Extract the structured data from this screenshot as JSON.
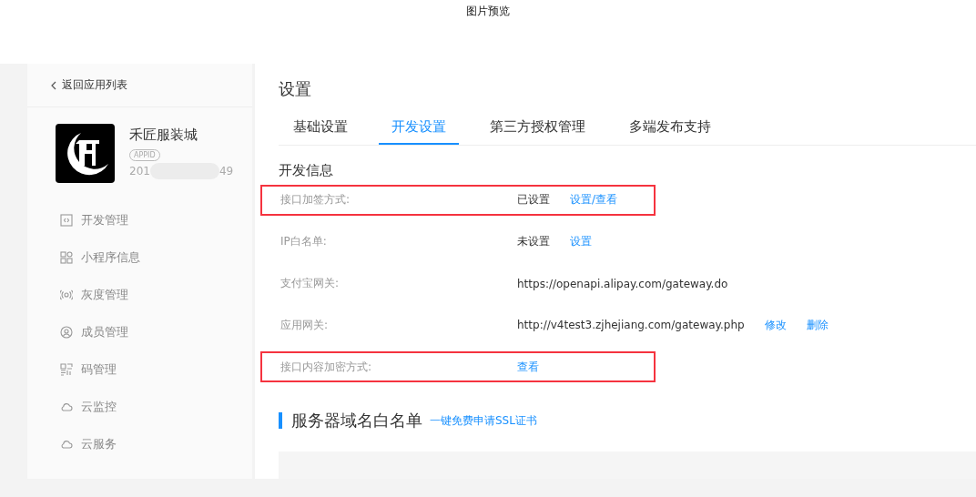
{
  "window": {
    "title": "图片预览"
  },
  "sidebar": {
    "back_link": "返回应用列表",
    "app": {
      "name": "禾匠服装城",
      "appid_badge": "APPID",
      "appid_start": "201",
      "appid_end": "49"
    },
    "items": [
      {
        "label": "开发管理",
        "kind": "code"
      },
      {
        "label": "小程序信息",
        "kind": "grid"
      },
      {
        "label": "灰度管理",
        "kind": "signal"
      },
      {
        "label": "成员管理",
        "kind": "user"
      },
      {
        "label": "码管理",
        "kind": "qr"
      },
      {
        "label": "云监控",
        "kind": "cloud"
      },
      {
        "label": "云服务",
        "kind": "cloud"
      }
    ]
  },
  "main": {
    "title": "设置",
    "tabs": [
      {
        "label": "基础设置",
        "selected": false
      },
      {
        "label": "开发设置",
        "selected": true
      },
      {
        "label": "第三方授权管理",
        "selected": false
      },
      {
        "label": "多端发布支持",
        "selected": false
      }
    ],
    "section_title": "开发信息",
    "rows": [
      {
        "label": "接口加签方式:",
        "value": "已设置",
        "actions": [
          "设置/查看"
        ],
        "highlighted": true
      },
      {
        "label": "IP白名单:",
        "value": "未设置",
        "actions": [
          "设置"
        ],
        "highlighted": false
      },
      {
        "label": "支付宝网关:",
        "value": "https://openapi.alipay.com/gateway.do",
        "actions": [],
        "highlighted": false
      },
      {
        "label": "应用网关:",
        "value": "http://v4test3.zjhejiang.com/gateway.php",
        "actions": [
          "修改",
          "删除"
        ],
        "highlighted": false
      },
      {
        "label": "接口内容加密方式:",
        "actions": [
          "查看"
        ],
        "highlighted": true
      }
    ],
    "server_section": {
      "title": "服务器域名白名单",
      "link": "一键免费申请SSL证书"
    }
  }
}
